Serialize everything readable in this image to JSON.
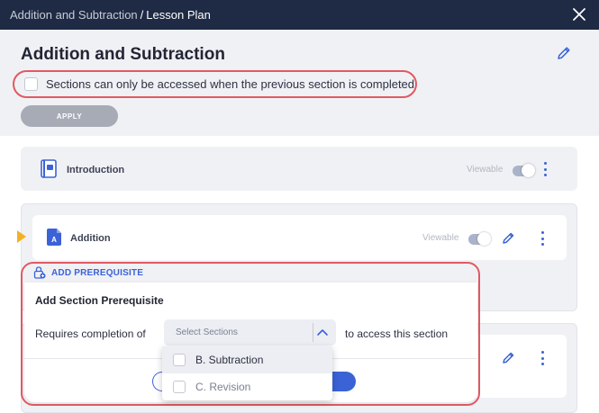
{
  "topbar": {
    "breadcrumb_parent": "Addition and Subtraction",
    "breadcrumb_separator": "/",
    "breadcrumb_current": "Lesson Plan"
  },
  "header": {
    "title": "Addition and Subtraction",
    "restrict_label": "Sections can only be accessed when the previous section is completed",
    "apply_label": "APPLY"
  },
  "sections": {
    "intro": {
      "name": "Introduction",
      "status": "Viewable"
    },
    "addition": {
      "name": "Addition",
      "status": "Viewable",
      "icon_letter": "A"
    }
  },
  "prerequisite": {
    "link_label": "ADD PREREQUISITE",
    "title": "Add Section Prerequisite",
    "requires_label": "Requires completion of",
    "select_placeholder": "Select Sections",
    "access_label": "to access this section",
    "options": [
      {
        "label": "B. Subtraction"
      },
      {
        "label": "C. Revision"
      }
    ]
  },
  "colors": {
    "topbar": "#1f2a44",
    "accent": "#3b63d6",
    "highlight_outline": "#e05a62",
    "marker": "#f3b122"
  }
}
